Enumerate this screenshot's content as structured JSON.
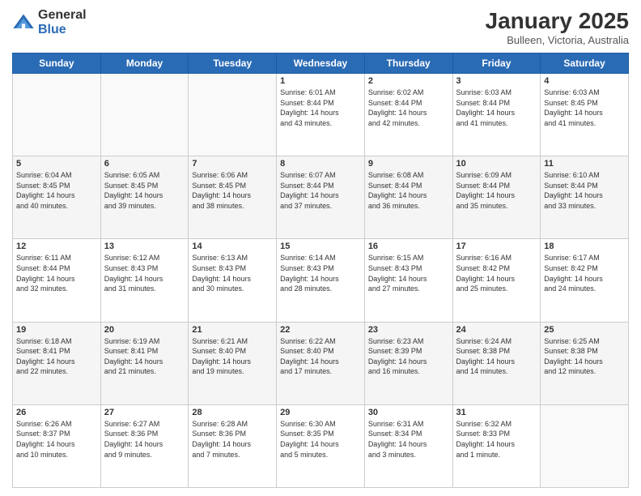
{
  "logo": {
    "general": "General",
    "blue": "Blue"
  },
  "title": "January 2025",
  "location": "Bulleen, Victoria, Australia",
  "days_header": [
    "Sunday",
    "Monday",
    "Tuesday",
    "Wednesday",
    "Thursday",
    "Friday",
    "Saturday"
  ],
  "weeks": [
    [
      {
        "day": "",
        "info": ""
      },
      {
        "day": "",
        "info": ""
      },
      {
        "day": "",
        "info": ""
      },
      {
        "day": "1",
        "info": "Sunrise: 6:01 AM\nSunset: 8:44 PM\nDaylight: 14 hours\nand 43 minutes."
      },
      {
        "day": "2",
        "info": "Sunrise: 6:02 AM\nSunset: 8:44 PM\nDaylight: 14 hours\nand 42 minutes."
      },
      {
        "day": "3",
        "info": "Sunrise: 6:03 AM\nSunset: 8:44 PM\nDaylight: 14 hours\nand 41 minutes."
      },
      {
        "day": "4",
        "info": "Sunrise: 6:03 AM\nSunset: 8:45 PM\nDaylight: 14 hours\nand 41 minutes."
      }
    ],
    [
      {
        "day": "5",
        "info": "Sunrise: 6:04 AM\nSunset: 8:45 PM\nDaylight: 14 hours\nand 40 minutes."
      },
      {
        "day": "6",
        "info": "Sunrise: 6:05 AM\nSunset: 8:45 PM\nDaylight: 14 hours\nand 39 minutes."
      },
      {
        "day": "7",
        "info": "Sunrise: 6:06 AM\nSunset: 8:45 PM\nDaylight: 14 hours\nand 38 minutes."
      },
      {
        "day": "8",
        "info": "Sunrise: 6:07 AM\nSunset: 8:44 PM\nDaylight: 14 hours\nand 37 minutes."
      },
      {
        "day": "9",
        "info": "Sunrise: 6:08 AM\nSunset: 8:44 PM\nDaylight: 14 hours\nand 36 minutes."
      },
      {
        "day": "10",
        "info": "Sunrise: 6:09 AM\nSunset: 8:44 PM\nDaylight: 14 hours\nand 35 minutes."
      },
      {
        "day": "11",
        "info": "Sunrise: 6:10 AM\nSunset: 8:44 PM\nDaylight: 14 hours\nand 33 minutes."
      }
    ],
    [
      {
        "day": "12",
        "info": "Sunrise: 6:11 AM\nSunset: 8:44 PM\nDaylight: 14 hours\nand 32 minutes."
      },
      {
        "day": "13",
        "info": "Sunrise: 6:12 AM\nSunset: 8:43 PM\nDaylight: 14 hours\nand 31 minutes."
      },
      {
        "day": "14",
        "info": "Sunrise: 6:13 AM\nSunset: 8:43 PM\nDaylight: 14 hours\nand 30 minutes."
      },
      {
        "day": "15",
        "info": "Sunrise: 6:14 AM\nSunset: 8:43 PM\nDaylight: 14 hours\nand 28 minutes."
      },
      {
        "day": "16",
        "info": "Sunrise: 6:15 AM\nSunset: 8:43 PM\nDaylight: 14 hours\nand 27 minutes."
      },
      {
        "day": "17",
        "info": "Sunrise: 6:16 AM\nSunset: 8:42 PM\nDaylight: 14 hours\nand 25 minutes."
      },
      {
        "day": "18",
        "info": "Sunrise: 6:17 AM\nSunset: 8:42 PM\nDaylight: 14 hours\nand 24 minutes."
      }
    ],
    [
      {
        "day": "19",
        "info": "Sunrise: 6:18 AM\nSunset: 8:41 PM\nDaylight: 14 hours\nand 22 minutes."
      },
      {
        "day": "20",
        "info": "Sunrise: 6:19 AM\nSunset: 8:41 PM\nDaylight: 14 hours\nand 21 minutes."
      },
      {
        "day": "21",
        "info": "Sunrise: 6:21 AM\nSunset: 8:40 PM\nDaylight: 14 hours\nand 19 minutes."
      },
      {
        "day": "22",
        "info": "Sunrise: 6:22 AM\nSunset: 8:40 PM\nDaylight: 14 hours\nand 17 minutes."
      },
      {
        "day": "23",
        "info": "Sunrise: 6:23 AM\nSunset: 8:39 PM\nDaylight: 14 hours\nand 16 minutes."
      },
      {
        "day": "24",
        "info": "Sunrise: 6:24 AM\nSunset: 8:38 PM\nDaylight: 14 hours\nand 14 minutes."
      },
      {
        "day": "25",
        "info": "Sunrise: 6:25 AM\nSunset: 8:38 PM\nDaylight: 14 hours\nand 12 minutes."
      }
    ],
    [
      {
        "day": "26",
        "info": "Sunrise: 6:26 AM\nSunset: 8:37 PM\nDaylight: 14 hours\nand 10 minutes."
      },
      {
        "day": "27",
        "info": "Sunrise: 6:27 AM\nSunset: 8:36 PM\nDaylight: 14 hours\nand 9 minutes."
      },
      {
        "day": "28",
        "info": "Sunrise: 6:28 AM\nSunset: 8:36 PM\nDaylight: 14 hours\nand 7 minutes."
      },
      {
        "day": "29",
        "info": "Sunrise: 6:30 AM\nSunset: 8:35 PM\nDaylight: 14 hours\nand 5 minutes."
      },
      {
        "day": "30",
        "info": "Sunrise: 6:31 AM\nSunset: 8:34 PM\nDaylight: 14 hours\nand 3 minutes."
      },
      {
        "day": "31",
        "info": "Sunrise: 6:32 AM\nSunset: 8:33 PM\nDaylight: 14 hours\nand 1 minute."
      },
      {
        "day": "",
        "info": ""
      }
    ]
  ]
}
